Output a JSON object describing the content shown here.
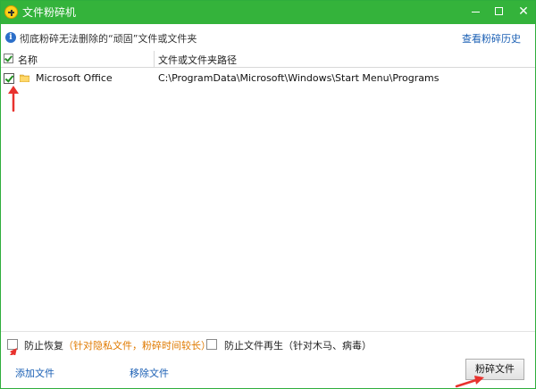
{
  "window": {
    "title": "文件粉碎机",
    "accent_color": "#34b33b"
  },
  "infobar": {
    "icon": "info-icon",
    "text": "彻底粉碎无法删除的“顽固”文件或文件夹",
    "history_link": "查看粉碎历史"
  },
  "table": {
    "columns": [
      "名称",
      "文件或文件夹路径"
    ],
    "header_checked": true,
    "rows": [
      {
        "checked": true,
        "icon": "folder-icon",
        "name": "Microsoft Office",
        "path": "C:\\ProgramData\\Microsoft\\Windows\\Start Menu\\Programs"
      }
    ]
  },
  "options": {
    "prevent_recovery": {
      "label": "防止恢复",
      "note": "（针对隐私文件，粉碎时间较长）",
      "checked": false
    },
    "prevent_regeneration": {
      "label": "防止文件再生（针对木马、病毒）",
      "checked": false
    }
  },
  "footer": {
    "add_file": "添加文件",
    "remove_file": "移除文件",
    "shred_button": "粉碎文件"
  },
  "colors": {
    "title_bar": "#34b33b",
    "link": "#1a5fb4",
    "note": "#e07a00",
    "annotation_arrow": "#e8322e"
  }
}
